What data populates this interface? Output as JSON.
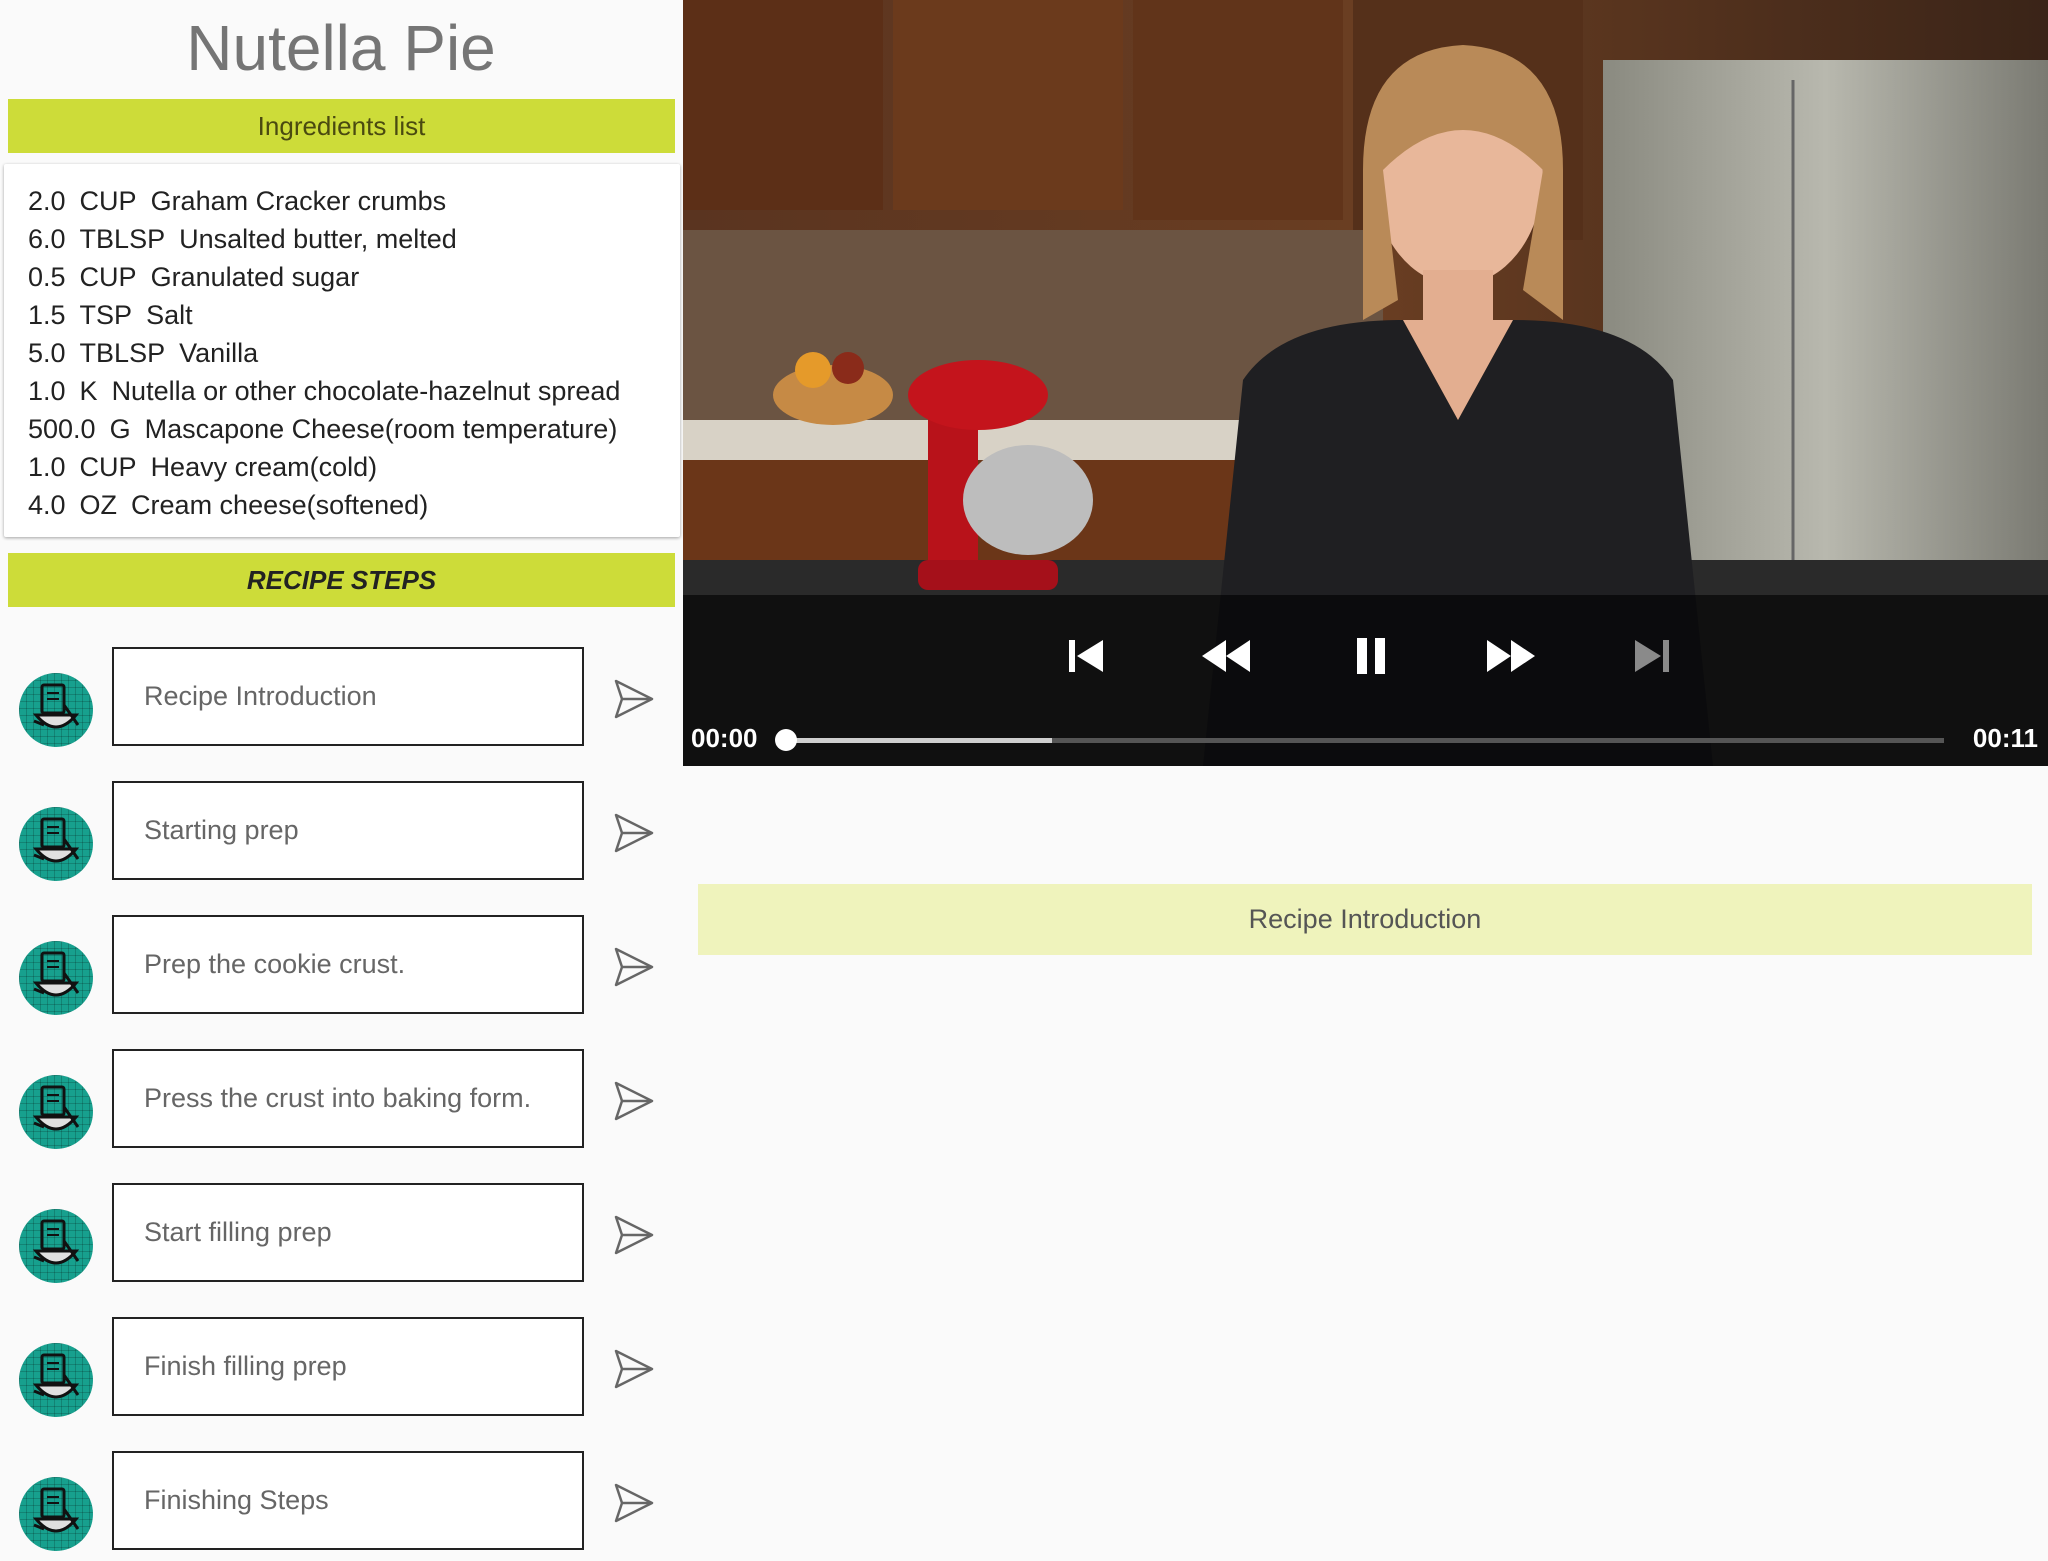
{
  "recipe": {
    "title": "Nutella Pie"
  },
  "ingredients": {
    "header": "Ingredients list",
    "items": [
      {
        "qty": "2.0",
        "unit": "CUP",
        "name": "Graham Cracker crumbs"
      },
      {
        "qty": "6.0",
        "unit": "TBLSP",
        "name": "Unsalted butter, melted"
      },
      {
        "qty": "0.5",
        "unit": "CUP",
        "name": "Granulated sugar"
      },
      {
        "qty": "1.5",
        "unit": "TSP",
        "name": "Salt"
      },
      {
        "qty": "5.0",
        "unit": "TBLSP",
        "name": "Vanilla"
      },
      {
        "qty": "1.0",
        "unit": "K",
        "name": "Nutella or other chocolate-hazelnut spread"
      },
      {
        "qty": "500.0",
        "unit": "G",
        "name": "Mascapone Cheese(room temperature)"
      },
      {
        "qty": "1.0",
        "unit": "CUP",
        "name": "Heavy cream(cold)"
      },
      {
        "qty": "4.0",
        "unit": "OZ",
        "name": "Cream cheese(softened)"
      }
    ]
  },
  "steps": {
    "header": "RECIPE STEPS",
    "items": [
      {
        "label": "Recipe Introduction"
      },
      {
        "label": "Starting prep"
      },
      {
        "label": "Prep the cookie crust."
      },
      {
        "label": "Press the crust into baking form."
      },
      {
        "label": "Start filling prep"
      },
      {
        "label": "Finish filling prep"
      },
      {
        "label": "Finishing Steps"
      }
    ]
  },
  "player": {
    "current_time": "00:00",
    "duration": "00:11",
    "buffered_fraction": 0.23,
    "played_fraction": 0.0,
    "state": "playing",
    "icons": [
      "skip-previous-icon",
      "rewind-icon",
      "pause-icon",
      "fast-forward-icon",
      "skip-next-icon"
    ]
  },
  "current_step": {
    "label": "Recipe Introduction"
  },
  "colors": {
    "accent": "#cddc39",
    "step_label_bg": "#eff3bc",
    "avatar": "#17a08e"
  }
}
